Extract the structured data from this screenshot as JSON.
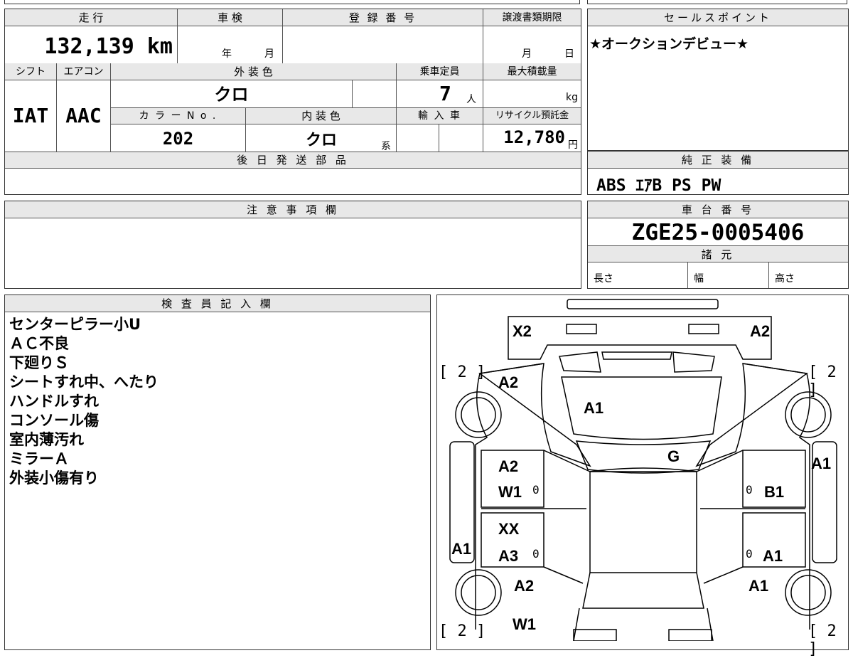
{
  "top_strip": {
    "hint": ""
  },
  "spec": {
    "mileage_label": "走 行",
    "mileage_value": "132,139 km",
    "inspection_label": "車 検",
    "inspection_year": "年",
    "inspection_month": "月",
    "registration_label": "登 録 番 号",
    "transfer_deadline_label": "譲渡書類期限",
    "transfer_month": "月",
    "transfer_day": "日",
    "shift_label": "シフト",
    "shift_value": "IAT",
    "aircon_label": "エアコン",
    "aircon_value": "AAC",
    "exterior_label": "外 装 色",
    "exterior_value": "クロ",
    "capacity_label": "乗車定員",
    "capacity_value": "7",
    "capacity_unit": "人",
    "max_load_label": "最大積載量",
    "max_load_unit": "kg",
    "color_no_label": "カ ラ ー N o .",
    "color_no_value": "202",
    "interior_label": "内 装 色",
    "interior_value": "クロ",
    "interior_unit": "系",
    "import_label": "輸 入 車",
    "recycle_label": "リサイクル預託金",
    "recycle_value": "12,780",
    "recycle_unit": "円",
    "later_parts_label": "後 日 発 送 部 品"
  },
  "sales_point": {
    "label": "セールスポイント",
    "text": "★オークションデビュー★"
  },
  "genuine": {
    "label": "純 正 装 備",
    "text": "ABS ｴｱB PS PW"
  },
  "notes": {
    "label": "注 意 事 項 欄"
  },
  "chassis": {
    "label": "車 台 番 号",
    "value": "ZGE25-0005406",
    "specs_label": "諸 元",
    "length": "長さ",
    "width": "幅",
    "height": "高さ"
  },
  "inspector": {
    "label": "検 査 員 記 入 欄",
    "lines": [
      "センターピラー小U",
      "ＡＣ不良",
      "下廻りＳ",
      "シートすれ中、へたり",
      "ハンドルすれ",
      "コンソール傷",
      "室内薄汚れ",
      "ミラーＡ",
      "外装小傷有り"
    ]
  },
  "diagram": {
    "marks": {
      "x2": "X2",
      "a2_top": "A2",
      "br_tl": "[ 2 ]",
      "br_tr": "[ 2 ]",
      "br_bl": "[ 2 ]",
      "br_br": "[ 2 ]",
      "a2_fl": "A2",
      "a1_hood": "A1",
      "g_windshield": "G",
      "a2_fdoor_l": "A2",
      "w1_fdoor_l": "W1",
      "zero_fl": "0",
      "zero_fr": "0",
      "b1_fdoor_r": "B1",
      "a1_fender_r": "A1",
      "xx_rdoor_l": "XX",
      "a3_rdoor_l": "A3",
      "zero_rl": "0",
      "a1_rocker_l": "A1",
      "zero_rr": "0",
      "a1_rdoor_r": "A1",
      "a2_rear_l": "A2",
      "a1_rear_r": "A1",
      "w1_rear": "W1"
    }
  }
}
